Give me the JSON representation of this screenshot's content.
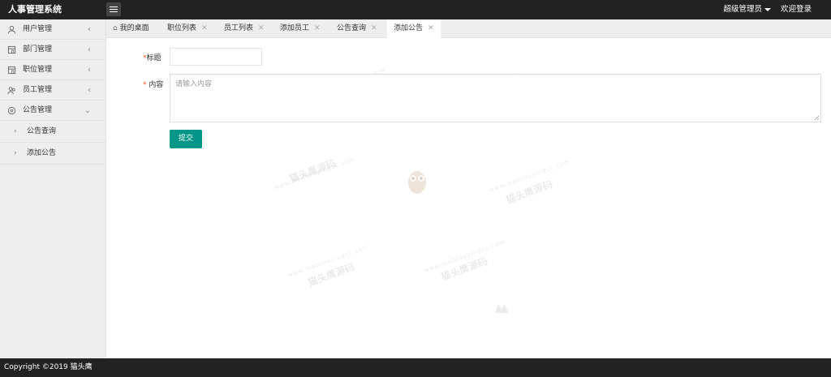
{
  "header": {
    "app_title": "人事管理系统",
    "admin_label": "超级管理员",
    "welcome_label": "欢迎登录"
  },
  "sidebar": {
    "items": [
      {
        "label": "用户管理",
        "icon": "user-icon"
      },
      {
        "label": "部门管理",
        "icon": "building-icon"
      },
      {
        "label": "职位管理",
        "icon": "building-icon"
      },
      {
        "label": "员工管理",
        "icon": "group-icon"
      },
      {
        "label": "公告管理",
        "icon": "notice-icon"
      }
    ],
    "sub_items": [
      "公告查询",
      "添加公告"
    ]
  },
  "tabs": [
    {
      "label": "我的桌面",
      "icon": "home-icon"
    },
    {
      "label": "职位列表"
    },
    {
      "label": "员工列表"
    },
    {
      "label": "添加员工"
    },
    {
      "label": "公告查询"
    },
    {
      "label": "添加公告",
      "active": true
    }
  ],
  "form": {
    "title_label": "标题",
    "title_value": "",
    "content_label": "内容",
    "content_placeholder": "请输入内容",
    "required_mark": "*",
    "submit_label": "提交"
  },
  "watermark": {
    "text": "猫头鹰源码",
    "url": "www.maotouyingcc.com"
  },
  "footer": {
    "copyright": "Copyright ©2019 猫头鹰"
  },
  "colors": {
    "topbar": "#222222",
    "primary": "#009688",
    "required": "#ff5722",
    "sidebar_bg": "#eeeeee"
  }
}
